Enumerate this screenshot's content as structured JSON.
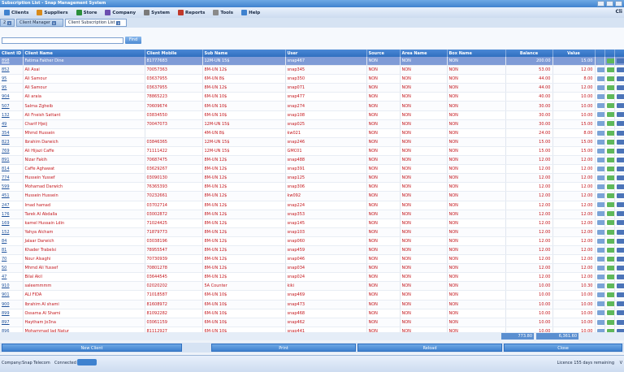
{
  "window": {
    "title": "Subscription List - Snap Management System"
  },
  "menu": [
    {
      "label": "Clients",
      "color": "#3f82cf"
    },
    {
      "label": "Suppliers",
      "color": "#d88a1a"
    },
    {
      "label": "Store",
      "color": "#2b8f3a"
    },
    {
      "label": "Company",
      "color": "#6b4fb0"
    },
    {
      "label": "System",
      "color": "#7a7a7a"
    },
    {
      "label": "Reports",
      "color": "#c0392b"
    },
    {
      "label": "Tools",
      "color": "#8a8a8a"
    },
    {
      "label": "Help",
      "color": "#3f82cf"
    }
  ],
  "menu_right": "Cli",
  "tabs": [
    "2",
    "Client Manager",
    "Client Subscription List"
  ],
  "find_label": "Find",
  "columns": [
    "Client ID",
    "Client Name",
    "Client Mobile",
    "Sub Name",
    "User",
    "Source",
    "Area Name",
    "Box Name",
    "Balance",
    "Value"
  ],
  "rows": [
    [
      "898",
      "Fatima Fakher Dine",
      "81777683",
      "12M-UN 15$",
      "snap467",
      "NON",
      "NON",
      "NON",
      "200.00",
      "15.00"
    ],
    [
      "852",
      "Ali Asai",
      "70057363",
      "8M-UN 12$",
      "snap345",
      "NON",
      "NON",
      "NON",
      "53.00",
      "12.00"
    ],
    [
      "95",
      "Ali Samour",
      "03637955",
      "6M-UN 8$",
      "snap350",
      "NON",
      "NON",
      "NON",
      "44.00",
      "8.00"
    ],
    [
      "95",
      "Ali Samour",
      "03637955",
      "8M-UN 12$",
      "snap071",
      "NON",
      "NON",
      "NON",
      "44.00",
      "12.00"
    ],
    [
      "904",
      "Ali araia",
      "78865223",
      "6M-UN 10$",
      "snap477",
      "NON",
      "NON",
      "NON",
      "40.00",
      "10.00"
    ],
    [
      "507",
      "Salma Zgheib",
      "70609674",
      "6M-UN 10$",
      "snap274",
      "NON",
      "NON",
      "NON",
      "30.00",
      "10.00"
    ],
    [
      "132",
      "Ali Fneish Sattant",
      "03834550",
      "6M-UN 10$",
      "snap108",
      "NON",
      "NON",
      "NON",
      "30.00",
      "10.00"
    ],
    [
      "49",
      "Charif Hjeij",
      "70047073",
      "12M-UN 15$",
      "snap025",
      "NON",
      "NON",
      "NON",
      "30.00",
      "15.00"
    ],
    [
      "354",
      "Mhmd Hussein",
      "",
      "4M-UN 8$",
      "kw021",
      "NON",
      "NON",
      "NON",
      "24.00",
      "8.00"
    ],
    [
      "823",
      "Ibrahim Darwich",
      "03846365",
      "12M-UN 15$",
      "snap246",
      "NON",
      "NON",
      "NON",
      "15.00",
      "15.00"
    ],
    [
      "769",
      "Ali Hijazi Caffe",
      "71111422",
      "12M-UN 15$",
      "GMC01",
      "NON",
      "NON",
      "NON",
      "15.00",
      "15.00"
    ],
    [
      "891",
      "Nizar Fakih",
      "70687475",
      "8M-UN 12$",
      "snap488",
      "NON",
      "NON",
      "NON",
      "12.00",
      "12.00"
    ],
    [
      "814",
      "Caffe Aghawat",
      "03629267",
      "8M-UN 12$",
      "snap391",
      "NON",
      "NON",
      "NON",
      "12.00",
      "12.00"
    ],
    [
      "774",
      "Hussein Yussef",
      "03090130",
      "8M-UN 12$",
      "snap125",
      "NON",
      "NON",
      "NON",
      "12.00",
      "12.00"
    ],
    [
      "599",
      "Mohamad Darwich",
      "76365393",
      "8M-UN 12$",
      "snap306",
      "NON",
      "NON",
      "NON",
      "12.00",
      "12.00"
    ],
    [
      "451",
      "Hussein Hussein",
      "70232661",
      "8M-UN 12$",
      "kw092",
      "NON",
      "NON",
      "NON",
      "12.00",
      "12.00"
    ],
    [
      "247",
      "Imad hamad",
      "03702714",
      "8M-UN 12$",
      "snap224",
      "NON",
      "NON",
      "NON",
      "12.00",
      "12.00"
    ],
    [
      "176",
      "Tarek Al Abdalla",
      "03002872",
      "8M-UN 12$",
      "snap353",
      "NON",
      "NON",
      "NON",
      "12.00",
      "12.00"
    ],
    [
      "169",
      "kamel Hussain Ldin",
      "71024425",
      "8M-UN 12$",
      "snap145",
      "NON",
      "NON",
      "NON",
      "12.00",
      "12.00"
    ],
    [
      "152",
      "Yahya Alcham",
      "71879773",
      "8M-UN 12$",
      "snap103",
      "NON",
      "NON",
      "NON",
      "12.00",
      "12.00"
    ],
    [
      "84",
      "Jalaar Darwich",
      "03038196",
      "8M-UN 12$",
      "snap060",
      "NON",
      "NON",
      "NON",
      "12.00",
      "12.00"
    ],
    [
      "81",
      "Khader Trabelsi",
      "78955547",
      "8M-UN 12$",
      "snap459",
      "NON",
      "NON",
      "NON",
      "12.00",
      "12.00"
    ],
    [
      "70",
      "Nour Alsaghi",
      "70730939",
      "8M-UN 12$",
      "snap046",
      "NON",
      "NON",
      "NON",
      "12.00",
      "12.00"
    ],
    [
      "50",
      "Mhmd Ali Yussef",
      "70801278",
      "8M-UN 12$",
      "snap034",
      "NON",
      "NON",
      "NON",
      "12.00",
      "12.00"
    ],
    [
      "47",
      "Bilal Akil",
      "03644545",
      "8M-UN 12$",
      "snap024",
      "NON",
      "NON",
      "NON",
      "12.00",
      "12.00"
    ],
    [
      "910",
      "saleemmmm",
      "02020202",
      "5A Counter",
      "kiki",
      "NON",
      "NON",
      "NON",
      "10.00",
      "10.30"
    ],
    [
      "901",
      "ALI FIDA",
      "71018587",
      "6M-UN 10$",
      "snap469",
      "NON",
      "NON",
      "NON",
      "10.00",
      "10.00"
    ],
    [
      "900",
      "Ibrahim Al shami",
      "81608972",
      "6M-UN 10$",
      "snap473",
      "NON",
      "NON",
      "NON",
      "10.00",
      "10.00"
    ],
    [
      "899",
      "Ossama Al Shami",
      "81092282",
      "6M-UN 10$",
      "snap468",
      "NON",
      "NON",
      "NON",
      "10.00",
      "10.00"
    ],
    [
      "897",
      "Haytham Jo3na",
      "03061159",
      "6M-UN 10$",
      "snap462",
      "NON",
      "NON",
      "NON",
      "10.00",
      "10.00"
    ],
    [
      "896",
      "Mohammad Jad Natur",
      "81112927",
      "6M-UN 10$",
      "snap441",
      "NON",
      "NON",
      "NON",
      "10.00",
      "10.00"
    ],
    [
      "895",
      "Ali Shibli",
      "76947397",
      "6M-UN 10$",
      "snap446",
      "NON",
      "NON",
      "NON",
      "10.00",
      "10.00"
    ],
    [
      "883",
      "Maher Mansour",
      "03910552",
      "6M-UN 10$",
      "snap440",
      "NON",
      "NON",
      "NON",
      "10.00",
      "10.00"
    ],
    [
      "880",
      "Hana Alfeel",
      "70074670",
      "6M-UN 10$",
      "snap061",
      "NON",
      "NON",
      "NON",
      "10.00",
      "10.00"
    ]
  ],
  "totals": {
    "balance": "773.80",
    "value": "6,361.60"
  },
  "buttons": {
    "new_client": "New Client",
    "print": "Print",
    "reload": "Reload",
    "close": "Close"
  },
  "status": {
    "company": "Company:Snap Telecom",
    "connected": "Connected",
    "licence": "Licence 155 days remaining",
    "end": "V"
  }
}
